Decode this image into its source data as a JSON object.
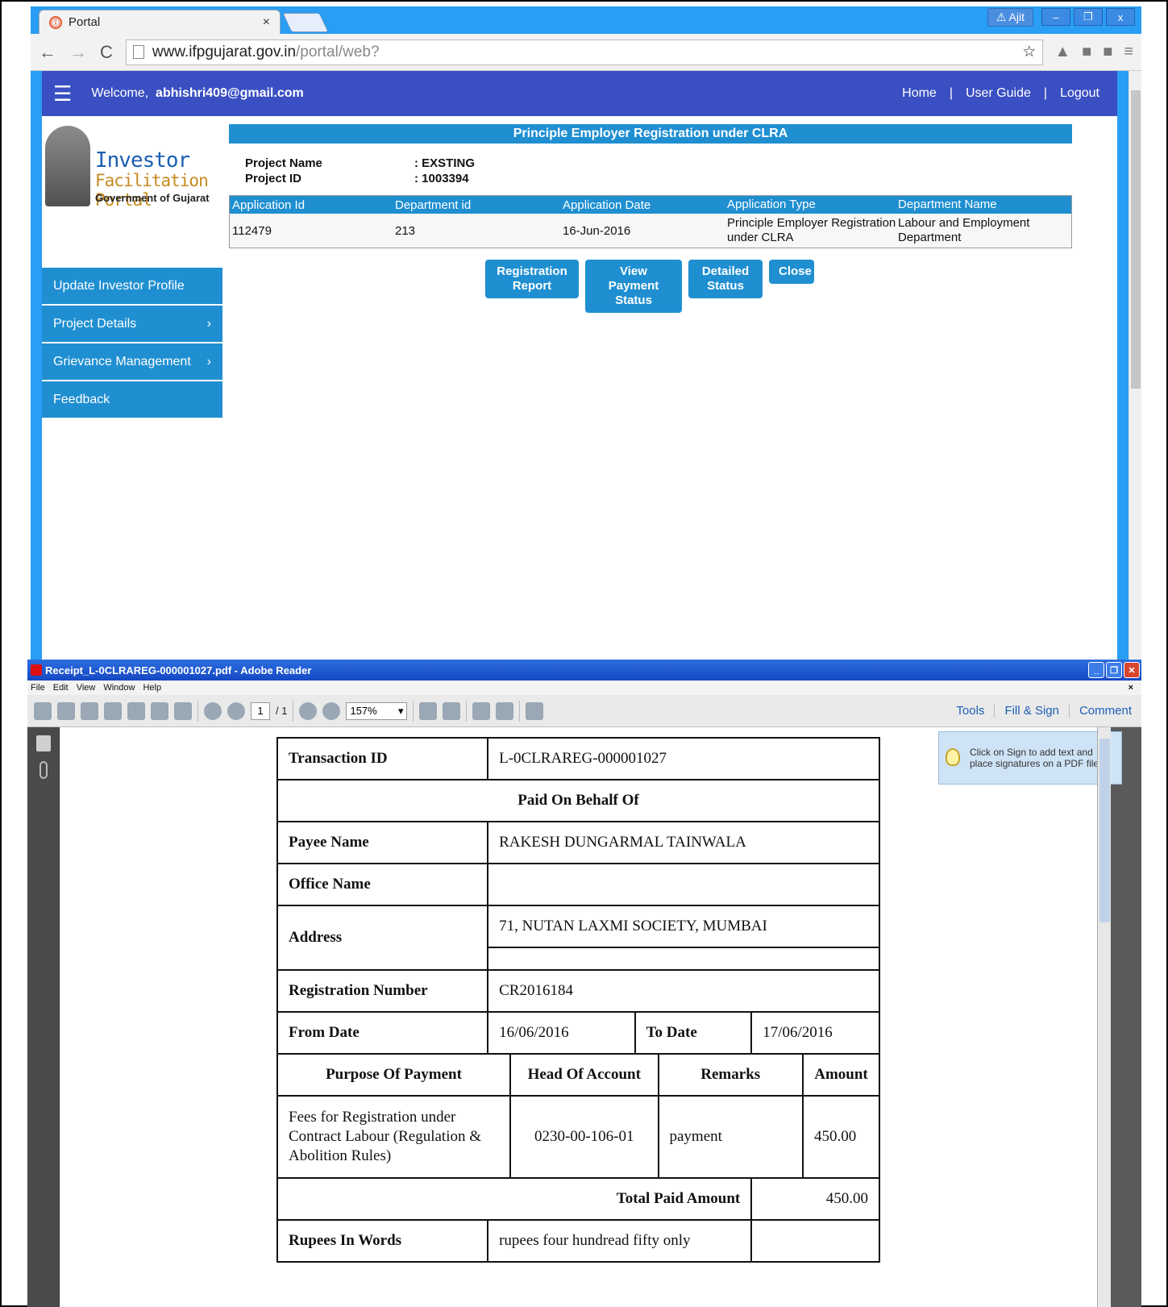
{
  "browser": {
    "tab_title": "Portal",
    "tab_close": "×",
    "user_label": "Ajit",
    "url_main": "www.ifpgujarat.gov.in",
    "url_path": "/portal/web?"
  },
  "site": {
    "welcome_prefix": "Welcome,",
    "user_email": "abhishri409@gmail.com",
    "top_links": [
      "Home",
      "User Guide",
      "Logout"
    ],
    "separator": "|",
    "logo": {
      "line1": "Investor",
      "line2": "Facilitation Portal",
      "line3": "Government of Gujarat"
    },
    "side_menu": [
      {
        "label": "Update Investor Profile",
        "chevron": ""
      },
      {
        "label": "Project Details",
        "chevron": "›"
      },
      {
        "label": "Grievance Management",
        "chevron": "›"
      },
      {
        "label": "Feedback",
        "chevron": ""
      }
    ],
    "page_title": "Principle Employer Registration under CLRA",
    "project": {
      "name_label": "Project Name",
      "name_value": ": EXSTING",
      "id_label": "Project ID",
      "id_value": ": 1003394"
    },
    "app_table": {
      "headers": [
        "Application Id",
        "Department id",
        "Application Date",
        "Application Type",
        "Department Name"
      ],
      "row": [
        "112479",
        "213",
        "16-Jun-2016",
        "Principle Employer Registration under CLRA",
        "Labour and Employment Department"
      ]
    },
    "buttons": {
      "registration_report": "Registration Report",
      "view_payment_status": "View Payment Status",
      "detailed_status": "Detailed Status",
      "close": "Close"
    }
  },
  "reader": {
    "title": "Receipt_L-0CLRAREG-000001027.pdf - Adobe Reader",
    "menu": [
      "File",
      "Edit",
      "View",
      "Window",
      "Help"
    ],
    "menu_close": "×",
    "page_current": "1",
    "page_total": "/ 1",
    "zoom": "157%",
    "right_links": [
      "Tools",
      "Fill & Sign",
      "Comment"
    ],
    "tip": "Click on Sign to add text and place signatures on a PDF file."
  },
  "receipt": {
    "transaction_id_label": "Transaction ID",
    "transaction_id": "L-0CLRAREG-000001027",
    "paid_on_behalf": "Paid On Behalf Of",
    "payee_name_label": "Payee Name",
    "payee_name": "RAKESH DUNGARMAL TAINWALA",
    "office_name_label": "Office Name",
    "office_name": "",
    "address_label": "Address",
    "address": "71, NUTAN LAXMI SOCIETY, MUMBAI",
    "registration_number_label": "Registration Number",
    "registration_number": "CR2016184",
    "from_date_label": "From Date",
    "from_date": "16/06/2016",
    "to_date_label": "To Date",
    "to_date": "17/06/2016",
    "cols": [
      "Purpose Of Payment",
      "Head Of Account",
      "Remarks",
      "Amount"
    ],
    "purpose": "Fees for Registration under Contract Labour (Regulation & Abolition Rules)",
    "head_of_account": "0230-00-106-01",
    "remarks": "payment",
    "amount": "450.00",
    "total_label": "Total Paid Amount",
    "total": "450.00",
    "words_label": "Rupees In Words",
    "words": "rupees four hundread fifty only"
  }
}
